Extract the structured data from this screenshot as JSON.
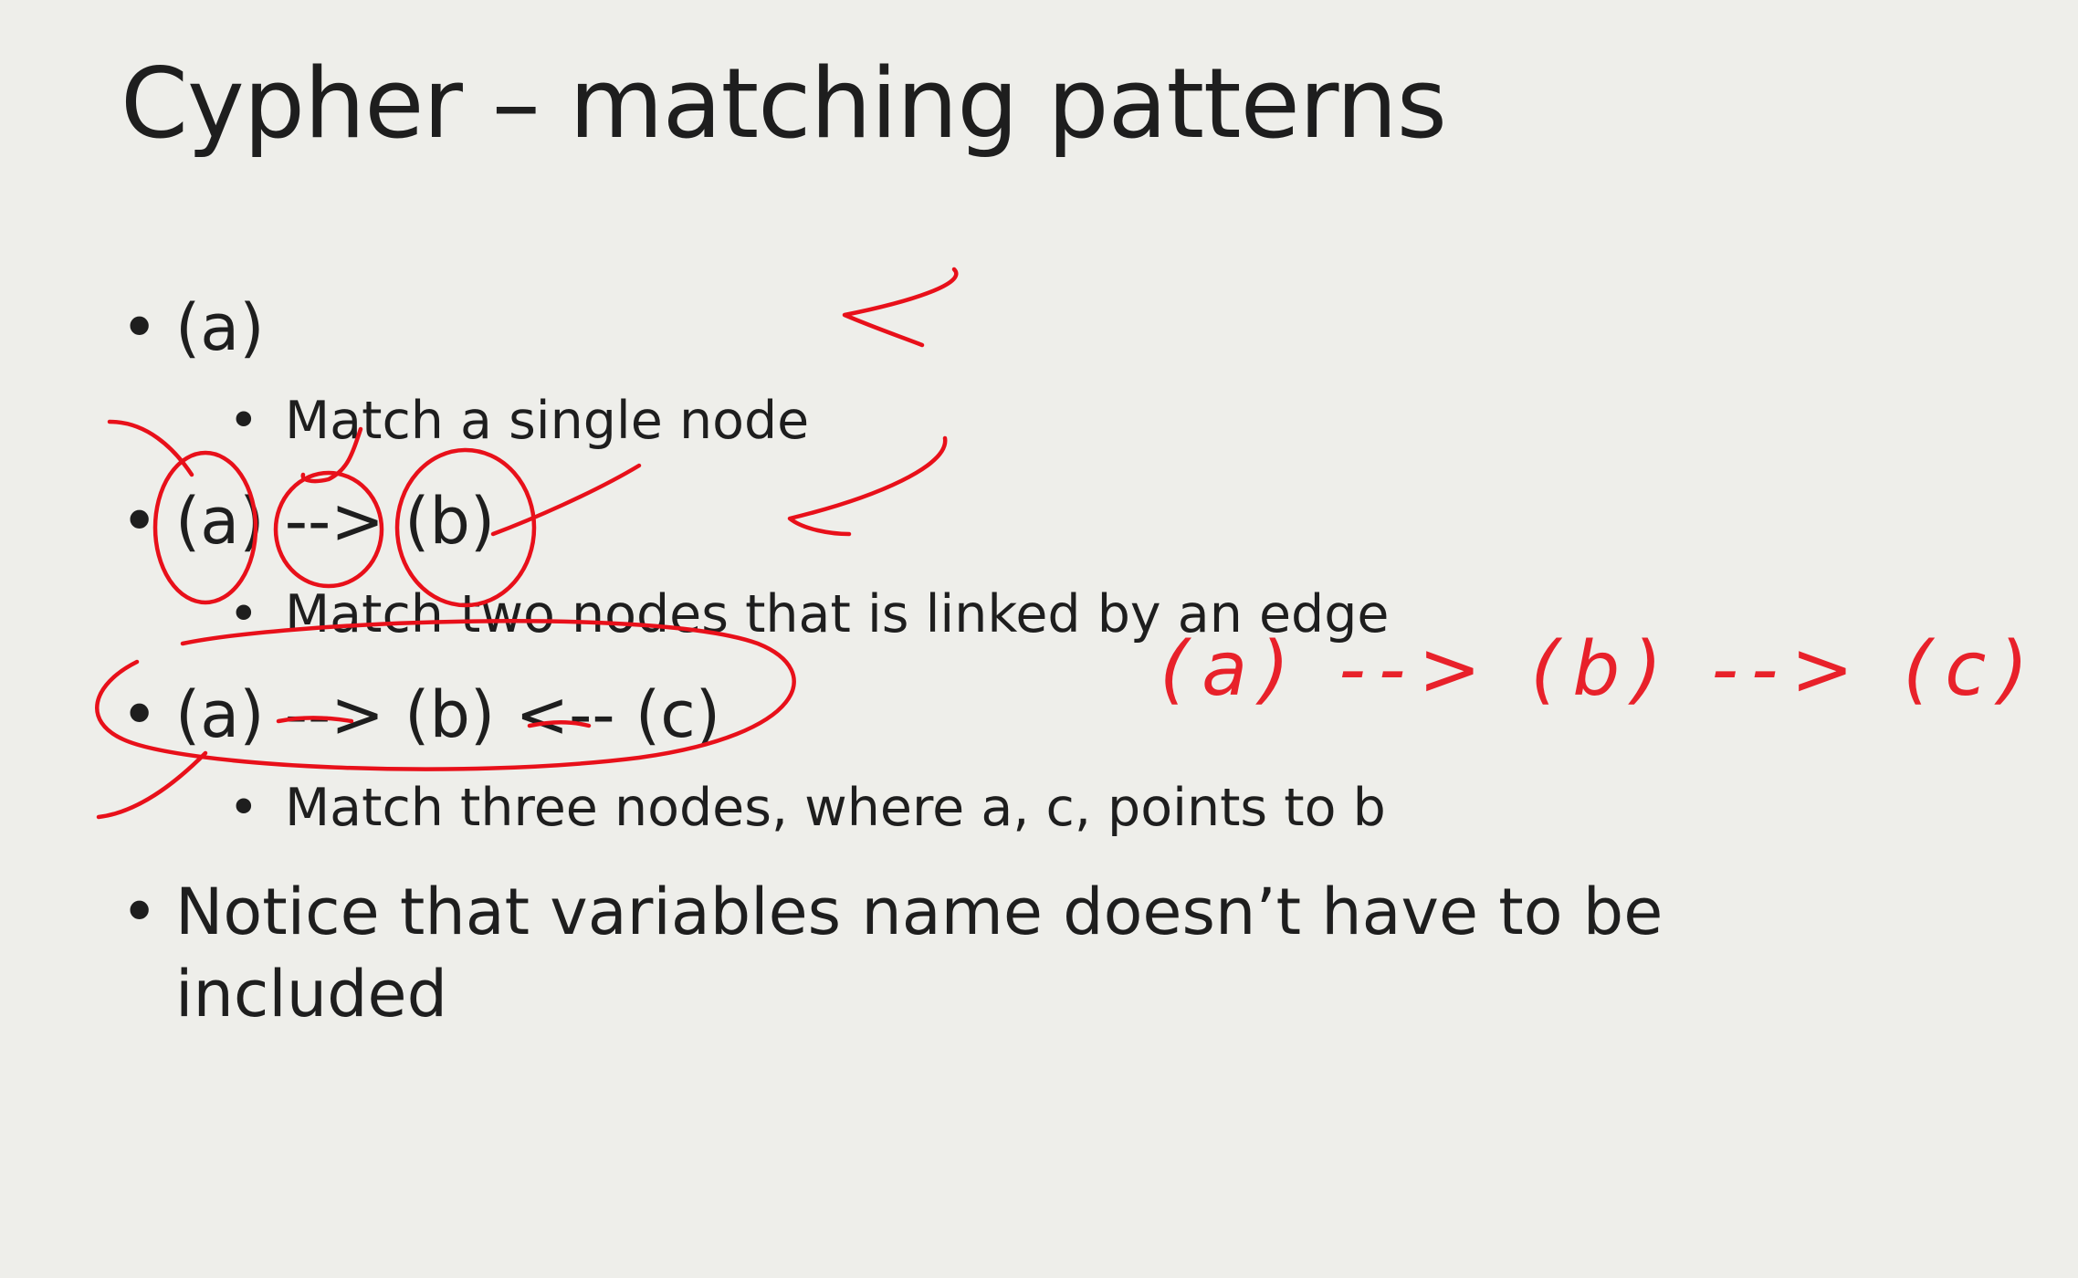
{
  "slide": {
    "title": "Cypher – matching patterns",
    "bullets": [
      {
        "text": "(a)",
        "sub": "Match a single node"
      },
      {
        "text": "(a) --> (b)",
        "sub": "Match two nodes that is linked by an edge"
      },
      {
        "text": "(a) --> (b) <-- (c)",
        "sub": "Match three nodes, where a, c, points to b"
      },
      {
        "text": "Notice that variables name doesn’t have to be",
        "continuation": "included"
      }
    ],
    "bullet_glyph": "•"
  },
  "annotations": {
    "handwritten_pattern": "(a) --> (b) --> (c)",
    "ink_color": "#e8101a"
  }
}
